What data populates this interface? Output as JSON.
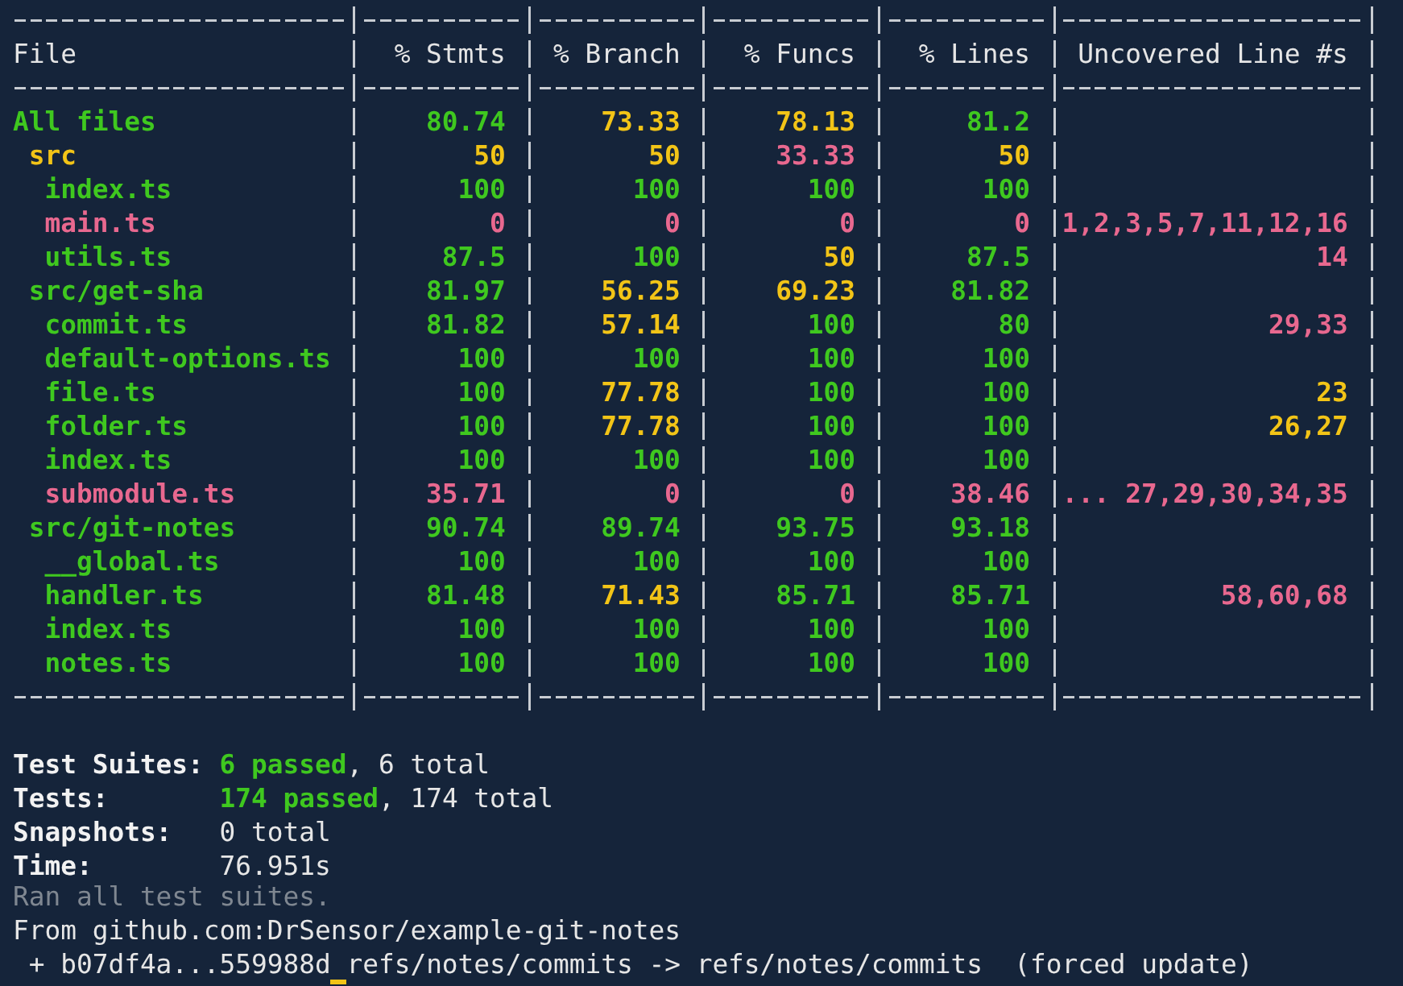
{
  "coverage_table": {
    "columns": [
      "File",
      "% Stmts",
      "% Branch",
      "% Funcs",
      "% Lines",
      "Uncovered Line #s"
    ],
    "rows": [
      {
        "cells": [
          {
            "text": "All files",
            "color": "#3fc81f"
          },
          {
            "text": "80.74",
            "color": "#3fc81f"
          },
          {
            "text": "73.33",
            "color": "#f2c417"
          },
          {
            "text": "78.13",
            "color": "#f2c417"
          },
          {
            "text": "81.2",
            "color": "#3fc81f"
          },
          ""
        ],
        "children": [
          {
            "cells": [
              {
                "text": "src",
                "color": "#f2c417"
              },
              {
                "text": "50",
                "color": "#f2c417"
              },
              {
                "text": "50",
                "color": "#f2c417"
              },
              {
                "text": "33.33",
                "color": "#e8688f"
              },
              {
                "text": "50",
                "color": "#f2c417"
              },
              ""
            ],
            "children": [
              {
                "cells": [
                  {
                    "text": "index.ts",
                    "color": "#3fc81f"
                  },
                  {
                    "text": "100",
                    "color": "#3fc81f"
                  },
                  {
                    "text": "100",
                    "color": "#3fc81f"
                  },
                  {
                    "text": "100",
                    "color": "#3fc81f"
                  },
                  {
                    "text": "100",
                    "color": "#3fc81f"
                  },
                  ""
                ]
              },
              {
                "cells": [
                  {
                    "text": "main.ts",
                    "color": "#e8688f"
                  },
                  {
                    "text": "0",
                    "color": "#e8688f"
                  },
                  {
                    "text": "0",
                    "color": "#e8688f"
                  },
                  {
                    "text": "0",
                    "color": "#e8688f"
                  },
                  {
                    "text": "0",
                    "color": "#e8688f"
                  },
                  {
                    "text": "1,2,3,5,7,11,12,16",
                    "color": "#e8688f"
                  }
                ]
              },
              {
                "cells": [
                  {
                    "text": "utils.ts",
                    "color": "#3fc81f"
                  },
                  {
                    "text": "87.5",
                    "color": "#3fc81f"
                  },
                  {
                    "text": "100",
                    "color": "#3fc81f"
                  },
                  {
                    "text": "50",
                    "color": "#f2c417"
                  },
                  {
                    "text": "87.5",
                    "color": "#3fc81f"
                  },
                  {
                    "text": "14",
                    "color": "#e8688f"
                  }
                ]
              }
            ]
          },
          {
            "cells": [
              {
                "text": "src/get-sha",
                "color": "#3fc81f"
              },
              {
                "text": "81.97",
                "color": "#3fc81f"
              },
              {
                "text": "56.25",
                "color": "#f2c417"
              },
              {
                "text": "69.23",
                "color": "#f2c417"
              },
              {
                "text": "81.82",
                "color": "#3fc81f"
              },
              ""
            ],
            "children": [
              {
                "cells": [
                  {
                    "text": "commit.ts",
                    "color": "#3fc81f"
                  },
                  {
                    "text": "81.82",
                    "color": "#3fc81f"
                  },
                  {
                    "text": "57.14",
                    "color": "#f2c417"
                  },
                  {
                    "text": "100",
                    "color": "#3fc81f"
                  },
                  {
                    "text": "80",
                    "color": "#3fc81f"
                  },
                  {
                    "text": "29,33",
                    "color": "#e8688f"
                  }
                ]
              },
              {
                "cells": [
                  {
                    "text": "default-options.ts",
                    "color": "#3fc81f"
                  },
                  {
                    "text": "100",
                    "color": "#3fc81f"
                  },
                  {
                    "text": "100",
                    "color": "#3fc81f"
                  },
                  {
                    "text": "100",
                    "color": "#3fc81f"
                  },
                  {
                    "text": "100",
                    "color": "#3fc81f"
                  },
                  ""
                ]
              },
              {
                "cells": [
                  {
                    "text": "file.ts",
                    "color": "#3fc81f"
                  },
                  {
                    "text": "100",
                    "color": "#3fc81f"
                  },
                  {
                    "text": "77.78",
                    "color": "#f2c417"
                  },
                  {
                    "text": "100",
                    "color": "#3fc81f"
                  },
                  {
                    "text": "100",
                    "color": "#3fc81f"
                  },
                  {
                    "text": "23",
                    "color": "#f2c417"
                  }
                ]
              },
              {
                "cells": [
                  {
                    "text": "folder.ts",
                    "color": "#3fc81f"
                  },
                  {
                    "text": "100",
                    "color": "#3fc81f"
                  },
                  {
                    "text": "77.78",
                    "color": "#f2c417"
                  },
                  {
                    "text": "100",
                    "color": "#3fc81f"
                  },
                  {
                    "text": "100",
                    "color": "#3fc81f"
                  },
                  {
                    "text": "26,27",
                    "color": "#f2c417"
                  }
                ]
              },
              {
                "cells": [
                  {
                    "text": "index.ts",
                    "color": "#3fc81f"
                  },
                  {
                    "text": "100",
                    "color": "#3fc81f"
                  },
                  {
                    "text": "100",
                    "color": "#3fc81f"
                  },
                  {
                    "text": "100",
                    "color": "#3fc81f"
                  },
                  {
                    "text": "100",
                    "color": "#3fc81f"
                  },
                  ""
                ]
              },
              {
                "cells": [
                  {
                    "text": "submodule.ts",
                    "color": "#e8688f"
                  },
                  {
                    "text": "35.71",
                    "color": "#e8688f"
                  },
                  {
                    "text": "0",
                    "color": "#e8688f"
                  },
                  {
                    "text": "0",
                    "color": "#e8688f"
                  },
                  {
                    "text": "38.46",
                    "color": "#e8688f"
                  },
                  {
                    "text": "... 27,29,30,34,35",
                    "color": "#e8688f"
                  }
                ]
              }
            ]
          },
          {
            "cells": [
              {
                "text": "src/git-notes",
                "color": "#3fc81f"
              },
              {
                "text": "90.74",
                "color": "#3fc81f"
              },
              {
                "text": "89.74",
                "color": "#3fc81f"
              },
              {
                "text": "93.75",
                "color": "#3fc81f"
              },
              {
                "text": "93.18",
                "color": "#3fc81f"
              },
              ""
            ],
            "children": [
              {
                "cells": [
                  {
                    "text": "__global.ts",
                    "color": "#3fc81f"
                  },
                  {
                    "text": "100",
                    "color": "#3fc81f"
                  },
                  {
                    "text": "100",
                    "color": "#3fc81f"
                  },
                  {
                    "text": "100",
                    "color": "#3fc81f"
                  },
                  {
                    "text": "100",
                    "color": "#3fc81f"
                  },
                  ""
                ]
              },
              {
                "cells": [
                  {
                    "text": "handler.ts",
                    "color": "#3fc81f"
                  },
                  {
                    "text": "81.48",
                    "color": "#3fc81f"
                  },
                  {
                    "text": "71.43",
                    "color": "#f2c417"
                  },
                  {
                    "text": "85.71",
                    "color": "#3fc81f"
                  },
                  {
                    "text": "85.71",
                    "color": "#3fc81f"
                  },
                  {
                    "text": "58,60,68",
                    "color": "#e8688f"
                  }
                ]
              },
              {
                "cells": [
                  {
                    "text": "index.ts",
                    "color": "#3fc81f"
                  },
                  {
                    "text": "100",
                    "color": "#3fc81f"
                  },
                  {
                    "text": "100",
                    "color": "#3fc81f"
                  },
                  {
                    "text": "100",
                    "color": "#3fc81f"
                  },
                  {
                    "text": "100",
                    "color": "#3fc81f"
                  },
                  ""
                ]
              },
              {
                "cells": [
                  {
                    "text": "notes.ts",
                    "color": "#3fc81f"
                  },
                  {
                    "text": "100",
                    "color": "#3fc81f"
                  },
                  {
                    "text": "100",
                    "color": "#3fc81f"
                  },
                  {
                    "text": "100",
                    "color": "#3fc81f"
                  },
                  {
                    "text": "100",
                    "color": "#3fc81f"
                  },
                  ""
                ]
              }
            ]
          }
        ]
      }
    ]
  },
  "summary": [
    {
      "label": "Test Suites:",
      "passed": "6 passed",
      "value": ", 6 total"
    },
    {
      "label": "Tests:",
      "passed": "174 passed",
      "value": ", 174 total"
    },
    {
      "label": "Snapshots:",
      "value": "0 total"
    },
    {
      "label": "Time:",
      "value": "76.951s"
    }
  ],
  "output_lines": [
    {
      "kind": "dim",
      "text": "Ran all test suites."
    },
    {
      "kind": "plain",
      "text": "From github.com:DrSensor/example-git-notes"
    },
    {
      "kind": "plain",
      "text": " + b07df4a...559988d refs/notes/commits -> refs/notes/commits  (forced update)"
    }
  ]
}
